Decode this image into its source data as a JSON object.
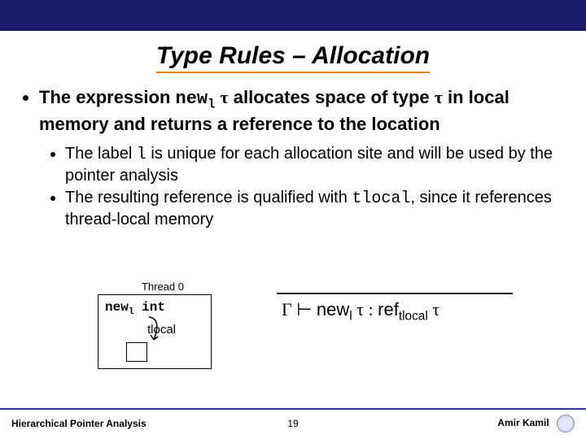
{
  "title": "Type Rules – Allocation",
  "main_bullet": {
    "prefix": "The expression ",
    "expr_new": "new",
    "expr_sub": "l",
    "expr_sp": " ",
    "tau1": "τ",
    "mid": " allocates space of type ",
    "tau2": "τ",
    "suffix": " in local memory and returns a reference to the location"
  },
  "sub_bullets": [
    {
      "a": "The label ",
      "code": "l",
      "b": " is unique for each allocation site and will be used by the pointer analysis"
    },
    {
      "a": "The resulting reference is qualified with ",
      "code": "tlocal",
      "b": ", since it references thread-local memory"
    }
  ],
  "diagram": {
    "thread_label": "Thread 0",
    "expr_new": "new",
    "expr_sub": "l",
    "expr_type": " int",
    "qualifier": "tlocal"
  },
  "rule": {
    "gamma": "Γ",
    "turnstile": " ⊢ ",
    "newword": "new",
    "sub_l": "l",
    "sp1": " ",
    "tau_a": "τ",
    "colon": " : ",
    "refword": "ref",
    "sub_q": "tlocal",
    "sp2": " ",
    "tau_b": "τ"
  },
  "footer": {
    "left": "Hierarchical Pointer Analysis",
    "page": "19",
    "author": "Amir Kamil"
  }
}
